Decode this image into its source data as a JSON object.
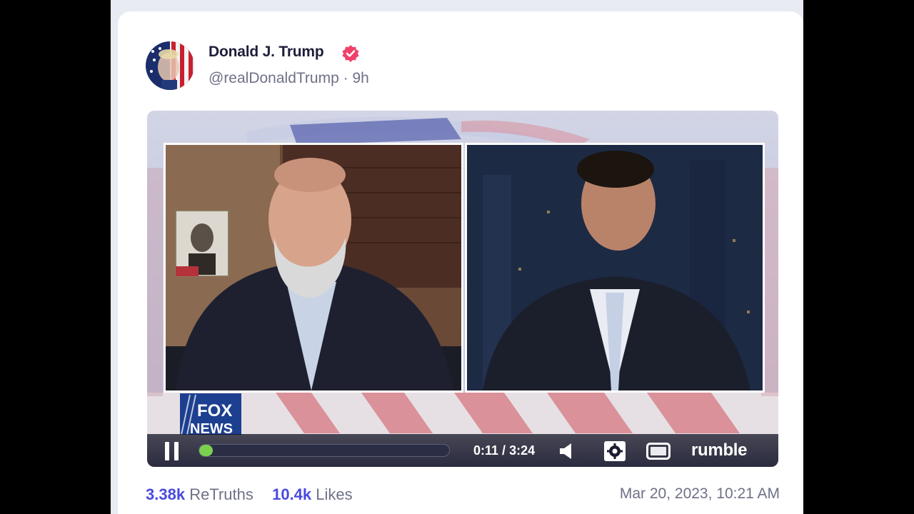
{
  "post": {
    "display_name": "Donald J. Trump",
    "handle": "@realDonaldTrump",
    "separator": "·",
    "time_ago": "9h",
    "verified_icon": "verified-badge-icon",
    "timestamp": "Mar 20, 2023, 10:21 AM"
  },
  "video": {
    "current_time": "0:11",
    "duration": "3:24",
    "time_separator": " / ",
    "progress_fraction": 0.054,
    "player_brand": "rumble",
    "channel_logo_line1": "FOX",
    "channel_logo_line2": "NEWS"
  },
  "stats": {
    "retruths_count": "3.38k",
    "retruths_label": "ReTruths",
    "likes_count": "10.4k",
    "likes_label": "Likes"
  },
  "colors": {
    "accent": "#4a4ae0",
    "verified": "#f0416a",
    "progress": "#7bd14f"
  }
}
